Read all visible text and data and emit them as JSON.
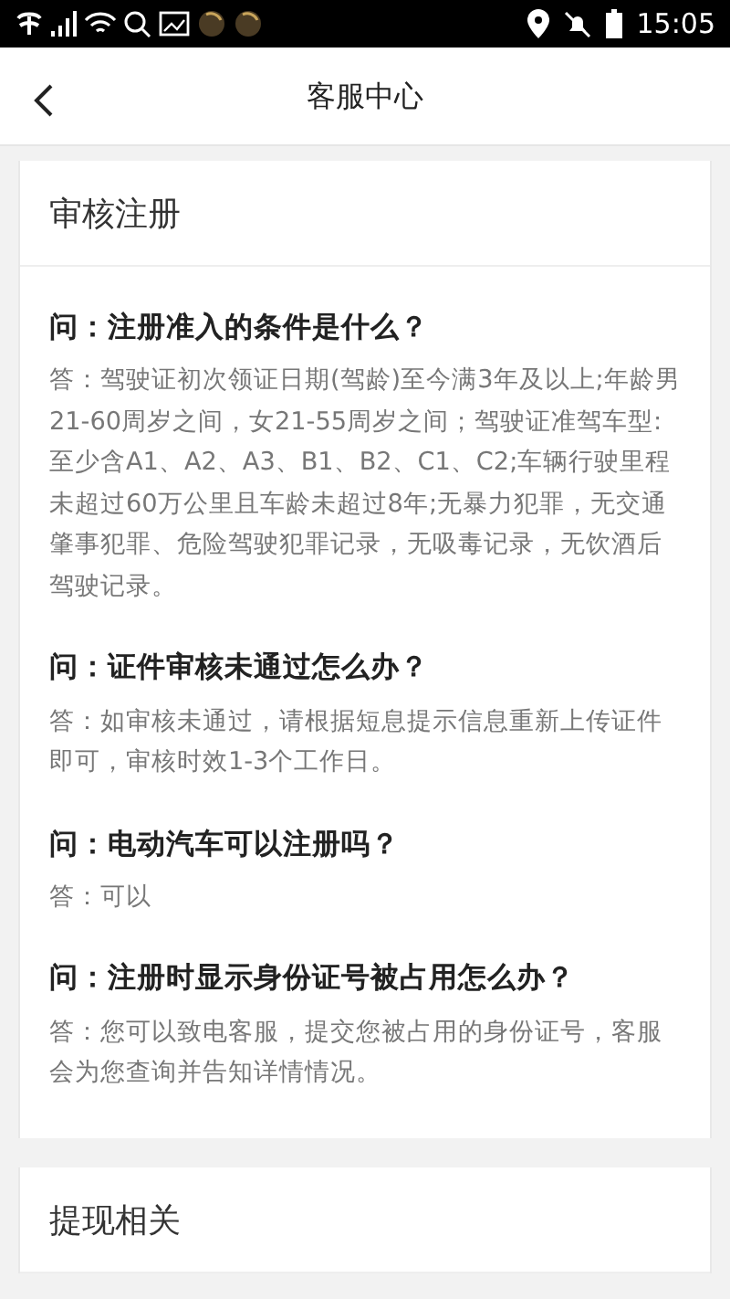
{
  "status_bar": {
    "time": "15:05"
  },
  "header": {
    "title": "客服中心"
  },
  "sections": [
    {
      "title": "审核注册",
      "faqs": [
        {
          "question": "问：注册准入的条件是什么？",
          "answer": "答：驾驶证初次领证日期(驾龄)至今满3年及以上;年龄男21-60周岁之间，女21-55周岁之间；驾驶证准驾车型:至少含A1、A2、A3、B1、B2、C1、C2;车辆行驶里程未超过60万公里且车龄未超过8年;无暴力犯罪，无交通肇事犯罪、危险驾驶犯罪记录，无吸毒记录，无饮酒后驾驶记录。"
        },
        {
          "question": "问：证件审核未通过怎么办？",
          "answer": "答：如审核未通过，请根据短息提示信息重新上传证件即可，审核时效1-3个工作日。"
        },
        {
          "question": "问：电动汽车可以注册吗？",
          "answer": "答：可以"
        },
        {
          "question": "问：注册时显示身份证号被占用怎么办？",
          "answer": "答：您可以致电客服，提交您被占用的身份证号，客服会为您查询并告知详情情况。"
        }
      ]
    },
    {
      "title": "提现相关"
    }
  ]
}
